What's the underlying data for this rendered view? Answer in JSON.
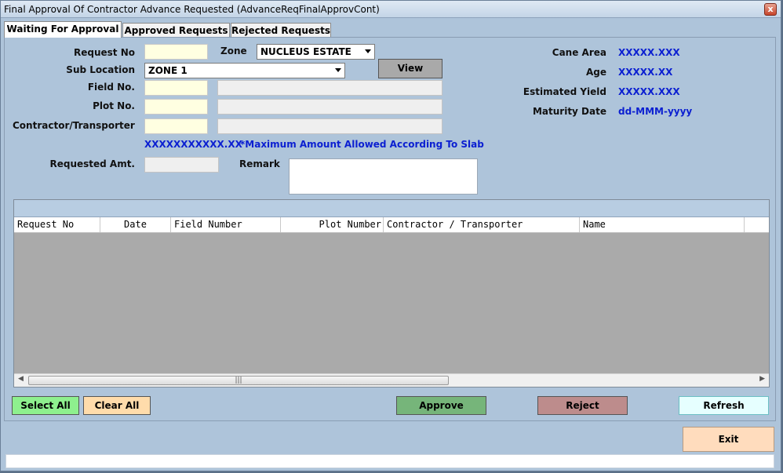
{
  "window": {
    "title": "Final Approval Of Contractor Advance Requested (AdvanceReqFinalApprovCont)",
    "close_label": "x"
  },
  "tabs": [
    {
      "label": "Waiting For Approval"
    },
    {
      "label": "Approved Requests"
    },
    {
      "label": "Rejected Requests"
    }
  ],
  "form": {
    "request_no_label": "Request No",
    "zone_label": "Zone",
    "zone_value": "NUCLEUS ESTATE",
    "sub_location_label": "Sub Location",
    "sub_location_value": "ZONE 1",
    "view_button": "View",
    "field_no_label": "Field  No.",
    "plot_no_label": "Plot No.",
    "contractor_label": "Contractor/Transporter",
    "amount_value": "XXXXXXXXXXX.XX",
    "slab_note": "*Maximum Amount Allowed According To Slab",
    "requested_amt_label": "Requested Amt.",
    "remark_label": "Remark"
  },
  "info": {
    "cane_area_label": "Cane Area",
    "cane_area_value": "XXXXX.XXX",
    "age_label": "Age",
    "age_value": "XXXXX.XX",
    "estimated_yield_label": "Estimated Yield",
    "estimated_yield_value": "XXXXX.XXX",
    "maturity_date_label": "Maturity Date",
    "maturity_date_value": "dd-MMM-yyyy"
  },
  "grid": {
    "columns": [
      "Request No",
      "Date",
      "Field Number",
      "Plot Number",
      "Contractor / Transporter",
      "Name"
    ],
    "rows": []
  },
  "buttons": {
    "select_all": "Select All",
    "clear_all": "Clear All",
    "approve": "Approve",
    "reject": "Reject",
    "refresh": "Refresh",
    "exit": "Exit"
  },
  "colors": {
    "window_bg": "#aec4da",
    "value_blue": "#0b1fd1",
    "select_all_bg": "#8ef08e",
    "clear_all_bg": "#ffdcab",
    "approve_bg": "#76b57a",
    "reject_bg": "#bd8c8c",
    "refresh_bg": "#e6ffff",
    "exit_bg": "#ffdcbd"
  }
}
